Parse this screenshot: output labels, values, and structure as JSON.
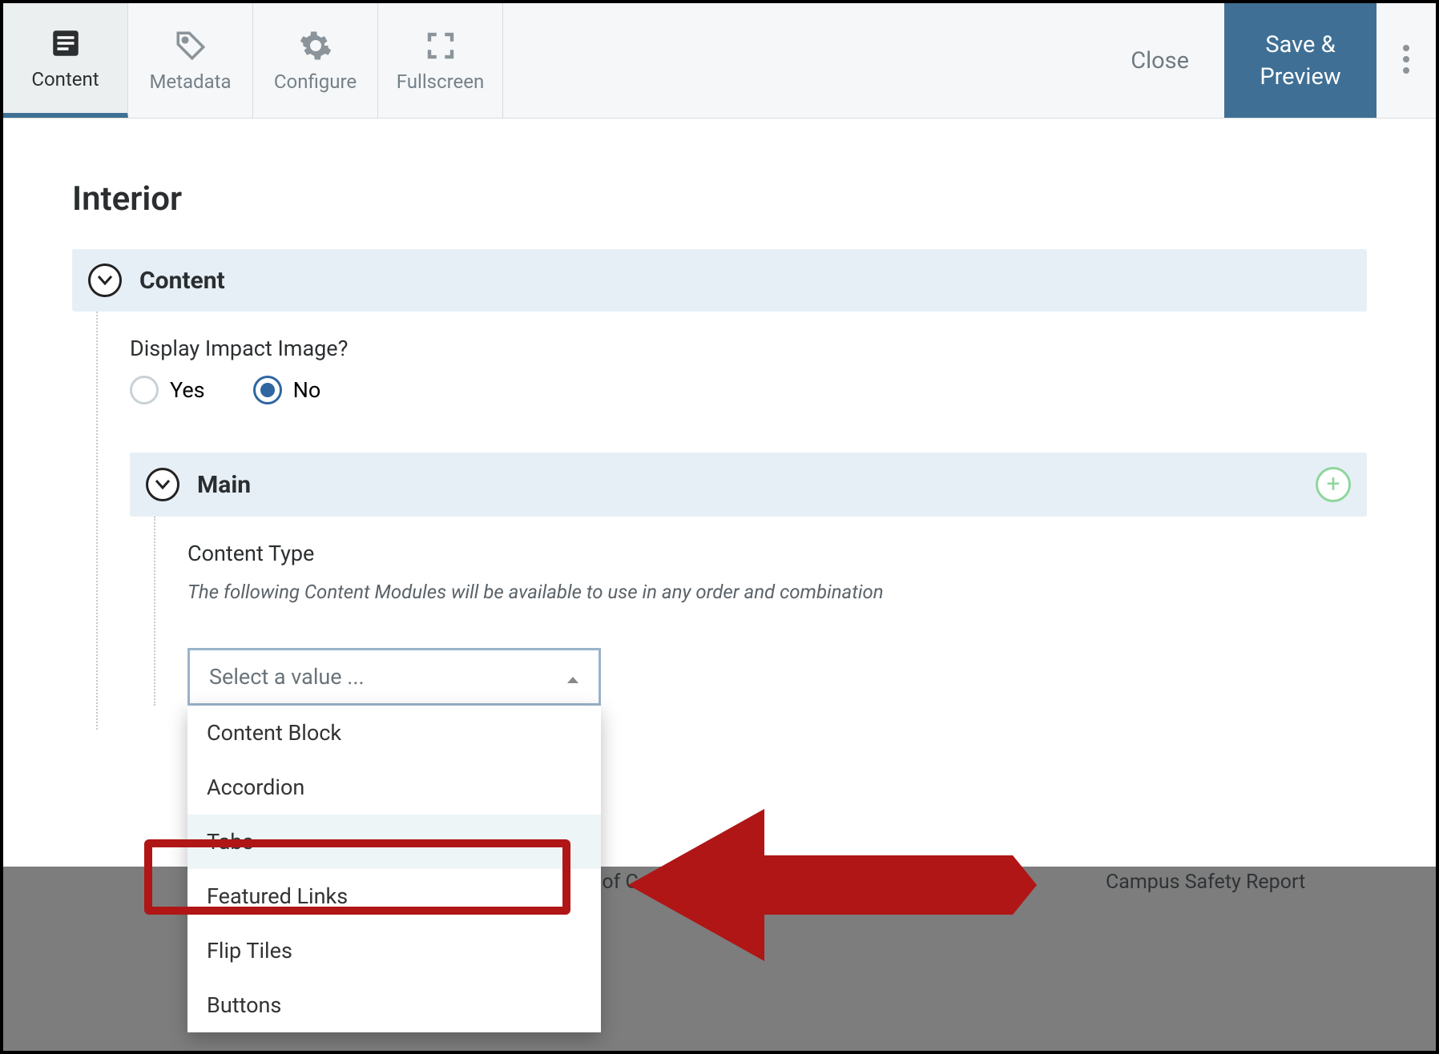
{
  "toolbar": {
    "tabs": [
      {
        "id": "content",
        "label": "Content"
      },
      {
        "id": "metadata",
        "label": "Metadata"
      },
      {
        "id": "configure",
        "label": "Configure"
      },
      {
        "id": "fullscreen",
        "label": "Fullscreen"
      }
    ],
    "close_label": "Close",
    "save_line1": "Save &",
    "save_line2": "Preview"
  },
  "page": {
    "title": "Interior",
    "content_section": "Content",
    "display_impact_label": "Display Impact Image?",
    "radio_yes": "Yes",
    "radio_no": "No",
    "radio_selected": "No",
    "main_section": "Main",
    "content_type_label": "Content Type",
    "content_type_hint": "The following Content Modules will be available to use in any order and combination",
    "dropdown_placeholder": "Select a value ...",
    "dropdown_options": [
      "Content Block",
      "Accordion",
      "Tabs",
      "Featured Links",
      "Flip Tiles",
      "Buttons"
    ],
    "dropdown_highlighted": "Tabs"
  },
  "footer": {
    "link1": "ook of Colleg",
    "link2": "Campus Safety Report"
  }
}
